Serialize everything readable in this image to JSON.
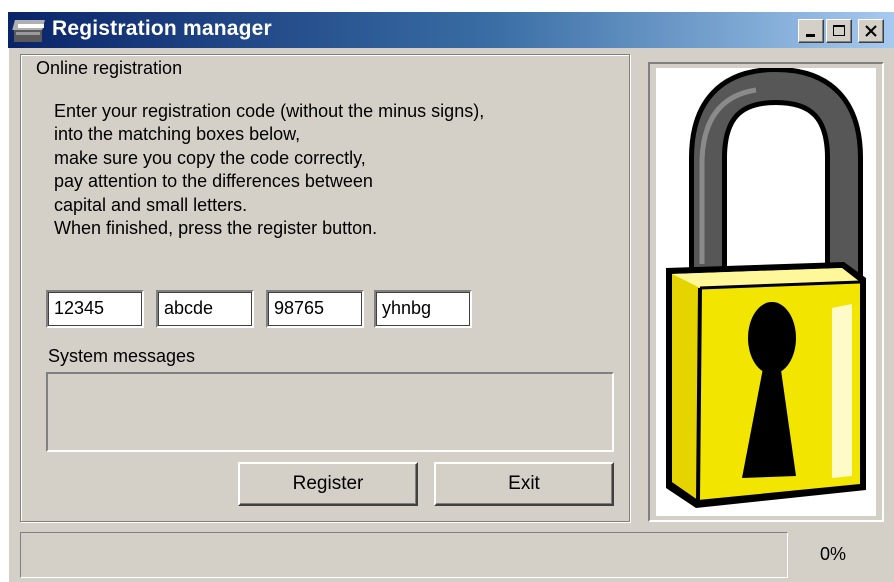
{
  "window": {
    "title": "Registration manager",
    "app_icon": "registration-app-icon",
    "caption_buttons": [
      "minimize",
      "maximize",
      "close"
    ]
  },
  "registration": {
    "group_title": "Online registration",
    "instructions": [
      "Enter your registration code (without the minus signs),",
      "into the matching boxes below,",
      "make sure you copy the code correctly,",
      "pay attention to the differences between",
      "capital and small letters.",
      "When finished, press the register button."
    ],
    "code_fields": [
      "12345",
      "abcde",
      "98765",
      "yhnbg"
    ],
    "system_messages_label": "System messages",
    "system_messages": "",
    "register_label": "Register",
    "exit_label": "Exit"
  },
  "image": {
    "icon": "padlock-icon",
    "colors": {
      "body": "#f2e600",
      "shackle": "#555555",
      "keyhole": "#000000"
    }
  },
  "status": {
    "progress_text": "0%",
    "progress_value": 0
  }
}
